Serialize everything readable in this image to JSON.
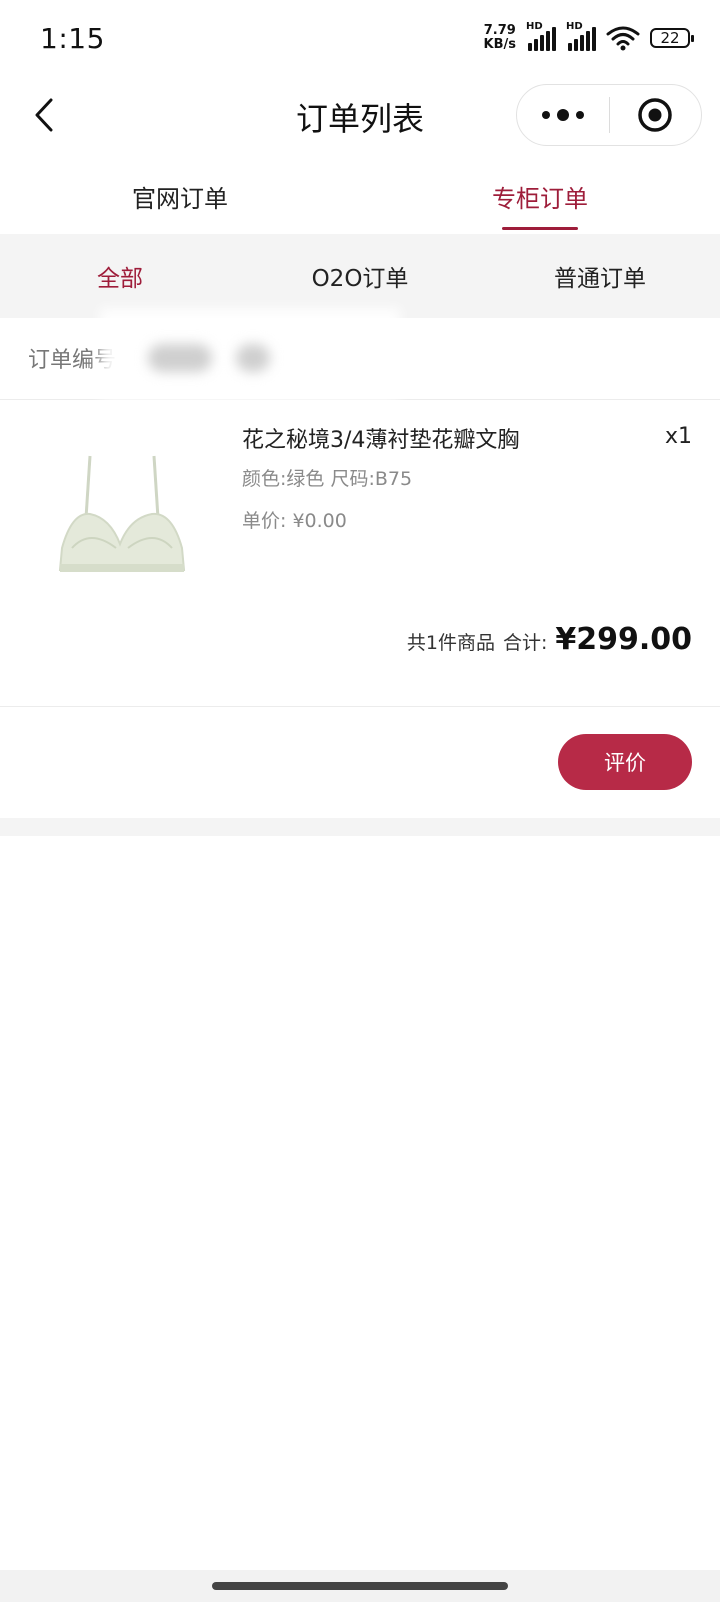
{
  "status_bar": {
    "time": "1:15",
    "net_speed_value": "7.79",
    "net_speed_unit": "KB/s",
    "hd_label": "HD",
    "battery": "22"
  },
  "nav": {
    "title": "订单列表"
  },
  "top_tabs": [
    {
      "label": "官网订单",
      "active": false
    },
    {
      "label": "专柜订单",
      "active": true
    }
  ],
  "sub_tabs": [
    {
      "label": "全部",
      "active": true
    },
    {
      "label": "O2O订单",
      "active": false
    },
    {
      "label": "普通订单",
      "active": false
    }
  ],
  "order": {
    "order_no_label": "订单编号",
    "product": {
      "name": "花之秘境3/4薄衬垫花瓣文胸",
      "quantity": "x1",
      "spec": "颜色:绿色 尺码:B75",
      "unit_price": "单价: ¥0.00"
    },
    "total_count": "共1件商品",
    "total_label": "合计:",
    "total_amount": "¥299.00",
    "review_button": "评价"
  },
  "colors": {
    "accent": "#9e1d3a",
    "button": "#b72a47",
    "subtab_bg": "#f4f4f4"
  }
}
